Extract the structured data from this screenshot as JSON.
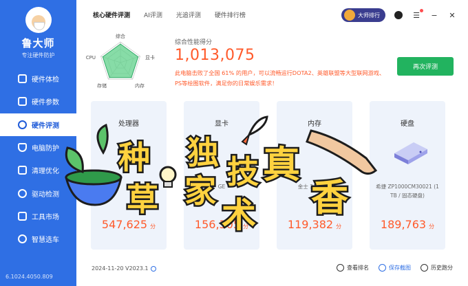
{
  "sidebar": {
    "app_name": "鲁大师",
    "app_sub": "专注硬件防护",
    "items": [
      {
        "label": "硬件体检",
        "icon": "monitor-icon"
      },
      {
        "label": "硬件参数",
        "icon": "chip-icon"
      },
      {
        "label": "硬件评测",
        "icon": "speed-gauge-icon"
      },
      {
        "label": "电脑防护",
        "icon": "shield-icon"
      },
      {
        "label": "清理优化",
        "icon": "broom-icon"
      },
      {
        "label": "驱动检测",
        "icon": "driver-icon"
      },
      {
        "label": "工具市场",
        "icon": "toolbox-icon"
      },
      {
        "label": "智慧选车",
        "icon": "car-icon"
      }
    ],
    "active_index": 2,
    "version": "6.1024.4050.809"
  },
  "header": {
    "tabs": [
      "核心硬件评测",
      "AI评测",
      "光追评测",
      "硬件排行榜"
    ],
    "active_tab": 0,
    "rank_button": "大师排行"
  },
  "radar": {
    "labels": [
      "综合",
      "显卡",
      "内存",
      "存储",
      "CPU"
    ]
  },
  "score": {
    "label": "综合性能得分",
    "value": "1,013,075",
    "description": "此电脑击败了全国 61% 的用户，可以流畅运行DOTA2、英雄联盟等大型联网游戏、PS等绘图软件，满足你的日常娱乐需求！",
    "retest_button": "再次评测"
  },
  "cards": [
    {
      "title": "处理器",
      "desc": "",
      "value": "547,625",
      "unit": "分"
    },
    {
      "title": "显卡",
      "desc": "GE",
      "value": "156,305",
      "unit": "分"
    },
    {
      "title": "内存",
      "desc": "金士 3600MH",
      "value": "119,382",
      "unit": "分"
    },
    {
      "title": "硬盘",
      "desc": "希捷 ZP1000CM30021 (1 TB / 固态硬盘)",
      "value": "189,763",
      "unit": "分"
    }
  ],
  "footer": {
    "date": "2024-11-20 V2023.1",
    "links": [
      "查看排名",
      "保存截图",
      "历史跑分"
    ]
  },
  "stickers": {
    "left": [
      "种",
      "草"
    ],
    "middle": [
      "独",
      "家",
      "技",
      "术"
    ],
    "right": [
      "真",
      "香"
    ]
  },
  "colors": {
    "sidebar": "#2f6fe4",
    "score": "#ff5a2b",
    "retest": "#22b35f",
    "radar_fill": "#5fd08a"
  }
}
